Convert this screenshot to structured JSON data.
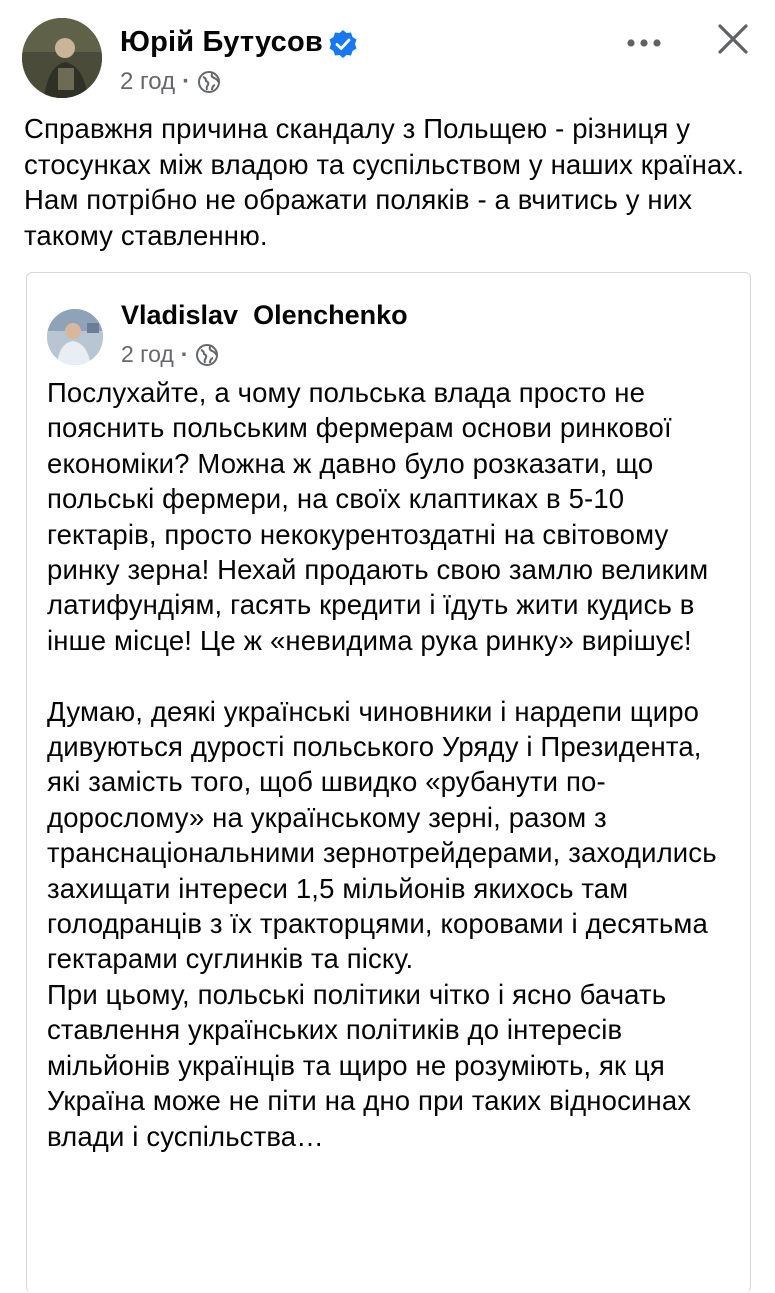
{
  "post": {
    "author_name": "Юрій Бутусов",
    "time": "2 год",
    "separator": "·",
    "text": "Справжня причина скандалу з Польщею - різниця у стосунках між владою та суспільством у наших країнах. Нам потрібно не ображати поляків - а вчитись у них такому ставленню."
  },
  "shared_post": {
    "author_name": "Vladislav  Olenchenko",
    "time": "2 год",
    "separator": "·",
    "paragraphs": [
      "Послухайте, а чому польська влада просто не пояснить польським фермерам основи ринкової економіки? Можна ж давно було розказати, що польські фермери, на своїх клаптиках в 5-10 гектарів, просто некокурентоздатні на світовому ринку зерна! Нехай продають свою замлю великим латифундіям, гасять кредити  і їдуть жити кудись в інше місце! Це ж  «невидима рука ринку» вирішує!",
      "Думаю, деякі українські чиновники  і нардепи щиро дивуються дурості польського Уряду і Президента, які замість того, щоб  швидко «рубанути по-дорослому» на українському зерні, разом з транснаціональними зернотрейдерами,  заходились захищати інтереси 1,5 мільйонів якихось там голодранців з їх тракторцями, коровами і десятьма гектарами суглинків та піску.",
      "При цьому, польські політики чітко і ясно бачать ставлення українських політиків до інтересів мільйонів українців та щиро не розуміють, як ця Україна може не піти на дно при таких відносинах влади і суспільства…"
    ]
  },
  "icons": {
    "verified": "verified-badge-icon",
    "globe": "globe-icon",
    "more": "more-options-icon",
    "close": "close-icon"
  },
  "colors": {
    "text": "#050505",
    "secondary_text": "#65676b",
    "verified_blue": "#1877f2",
    "card_border": "#d4d6da"
  }
}
